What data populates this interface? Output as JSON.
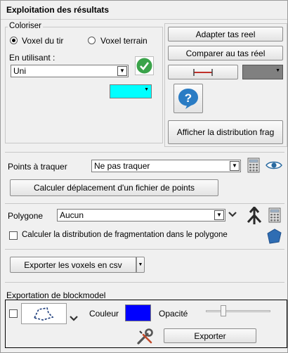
{
  "panel": {
    "title": "Exploitation des résultats"
  },
  "colorize": {
    "legend": "Coloriser",
    "radio_voxel_tir": "Voxel du tir",
    "radio_voxel_terrain": "Voxel terrain",
    "using_label": "En utilisant :",
    "using_value": "Uni",
    "color_cyan": "#00ffff"
  },
  "buttons": {
    "adapter": "Adapter tas reel",
    "comparer": "Comparer au tas réel",
    "afficher": "Afficher la distribution frag",
    "calculer_deplacement": "Calculer déplacement d'un fichier de points",
    "exporter_voxels": "Exporter les voxels en csv",
    "exporter": "Exporter"
  },
  "line_color": "#808080",
  "points": {
    "label": "Points à traquer",
    "value": "Ne pas traquer"
  },
  "polygone": {
    "label": "Polygone",
    "value": "Aucun",
    "checkbox_label": "Calculer la distribution de fragmentation dans le polygone"
  },
  "blockmodel": {
    "legend": "Exportation de blockmodel",
    "color_label": "Couleur",
    "color": "#0000ff",
    "opacity_label": "Opacité",
    "opacity": 0.25
  },
  "icons": {
    "ok": "check-circle-icon",
    "help": "question-bubble-icon",
    "calculator": "calculator-icon",
    "eye": "eye-icon",
    "merge": "merge-arrow-icon",
    "polygon": "polygon-icon",
    "tools": "wrench-screwdriver-icon"
  }
}
